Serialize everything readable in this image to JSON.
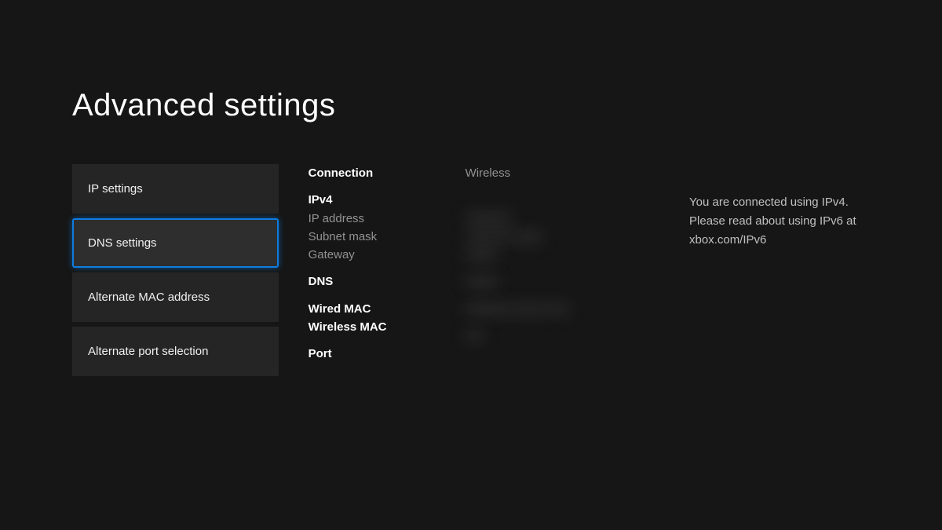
{
  "page_title": "Advanced settings",
  "menu": {
    "items": [
      {
        "label": "IP settings",
        "selected": false
      },
      {
        "label": "DNS settings",
        "selected": true
      },
      {
        "label": "Alternate MAC address",
        "selected": false
      },
      {
        "label": "Alternate port selection",
        "selected": false
      }
    ]
  },
  "details": {
    "connection": {
      "label": "Connection",
      "value": "Wireless"
    },
    "ipv4": {
      "label": "IPv4",
      "ip_address_label": "IP address",
      "subnet_mask_label": "Subnet mask",
      "gateway_label": "Gateway",
      "ip_address_value": "redacted",
      "subnet_mask_value": "redacted value",
      "gateway_value": "redact"
    },
    "dns": {
      "label": "DNS",
      "value": "redact"
    },
    "wired_mac": {
      "label": "Wired MAC",
      "value": "redacted value here"
    },
    "wireless_mac": {
      "label": "Wireless MAC",
      "value": ""
    },
    "port": {
      "label": "Port",
      "value": "red"
    }
  },
  "info": {
    "text": "You are connected using IPv4. Please read about using IPv6 at xbox.com/IPv6"
  }
}
